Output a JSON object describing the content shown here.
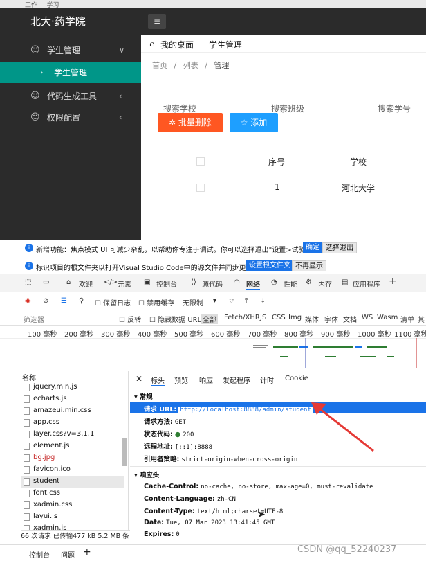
{
  "taskbar": {
    "items": [
      "工作",
      "学习"
    ]
  },
  "app": {
    "brand": "北大·药学院",
    "sidebar": [
      {
        "label": "学生管理",
        "icon": "smile-icon",
        "chev": "∨"
      },
      {
        "label": "学生管理",
        "active": true,
        "chev": "›"
      },
      {
        "label": "代码生成工具",
        "icon": "smile-icon",
        "chev": "‹"
      },
      {
        "label": "权限配置",
        "icon": "smile-icon",
        "chev": "‹"
      }
    ],
    "menu_icon": "≡",
    "tabs": {
      "home": "我的桌面",
      "current": "学生管理"
    },
    "breadcrumb": [
      "首页",
      "列表",
      "管理"
    ],
    "search": [
      "搜索学校",
      "搜索班级",
      "搜索学号"
    ],
    "buttons": {
      "delete": "批量删除",
      "add": "添加"
    },
    "table": {
      "headers": [
        "序号",
        "学校"
      ],
      "rows": [
        [
          "1",
          "河北大学"
        ]
      ]
    }
  },
  "notices": [
    {
      "text": "新增功能：焦点模式 UI 可减少杂乱，以帮助你专注于调试。你可以选择退出\"设置>试验\"。",
      "btn1": "确定",
      "btn2": "选择退出"
    },
    {
      "text": "标识项目的根文件夹以打开Visual Studio Code中的源文件并同步更改。",
      "btn1": "设置根文件夹",
      "btn2": "不再显示"
    }
  ],
  "devtools_tabs": [
    "欢迎",
    "元素",
    "控制台",
    "源代码",
    "网络",
    "性能",
    "内存",
    "应用程序"
  ],
  "toolbar": {
    "preserve_log": "保留日志",
    "disable_cache": "禁用缓存",
    "throttle": "无限制"
  },
  "filter": {
    "label": "筛选器",
    "invert": "反转",
    "hide_data_url": "隐藏数据 URL",
    "types": [
      "全部",
      "Fetch/XHR",
      "JS",
      "CSS",
      "Img",
      "媒体",
      "字体",
      "文档",
      "WS",
      "Wasm",
      "清单",
      "其"
    ]
  },
  "timeline_ticks": [
    "100 毫秒",
    "200 毫秒",
    "300 毫秒",
    "400 毫秒",
    "500 毫秒",
    "600 毫秒",
    "700 毫秒",
    "800 毫秒",
    "900 毫秒",
    "1000 毫秒",
    "1100 毫秒"
  ],
  "files": {
    "header": "名称",
    "items": [
      "jquery.min.js",
      "echarts.js",
      "amazeui.min.css",
      "app.css",
      "layer.css?v=3.1.1",
      "element.js",
      "bg.jpg",
      "favicon.ico",
      "student",
      "font.css",
      "xadmin.css",
      "layui.js",
      "xadmin.js"
    ]
  },
  "detail": {
    "tabs": [
      "标头",
      "预览",
      "响应",
      "发起程序",
      "计时",
      "Cookie"
    ],
    "general_title": "常规",
    "general": [
      {
        "k": "请求 URL:",
        "v": "http://localhost:8888/admin/student"
      },
      {
        "k": "请求方法:",
        "v": "GET"
      },
      {
        "k": "状态代码:",
        "v": "200"
      },
      {
        "k": "远程地址:",
        "v": "[::1]:8888"
      },
      {
        "k": "引用者策略:",
        "v": "strict-origin-when-cross-origin"
      }
    ],
    "response_title": "响应头",
    "response": [
      {
        "k": "Cache-Control:",
        "v": "no-cache, no-store, max-age=0, must-revalidate"
      },
      {
        "k": "Content-Language:",
        "v": "zh-CN"
      },
      {
        "k": "Content-Type:",
        "v": "text/html;charset=UTF-8"
      },
      {
        "k": "Date:",
        "v": "Tue, 07 Mar 2023 13:41:45 GMT"
      },
      {
        "k": "Expires:",
        "v": "0"
      }
    ]
  },
  "status": "66 次请求  已传输477 kB  5.2 MB 条",
  "drawer": [
    "控制台",
    "问题"
  ],
  "watermark": "CSDN @qq_52240237"
}
